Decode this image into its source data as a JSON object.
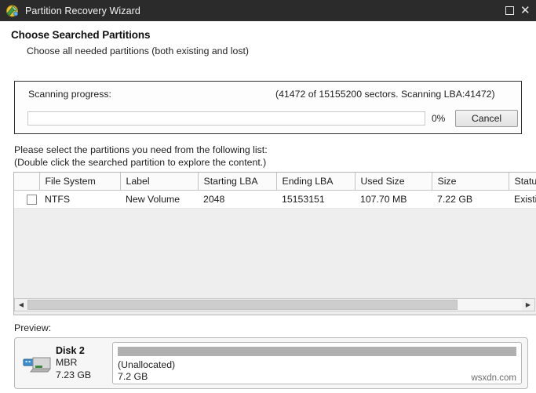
{
  "window": {
    "title": "Partition Recovery Wizard",
    "icon": "partition-wizard-icon",
    "maximize_label": "□",
    "close_label": "✕"
  },
  "header": {
    "title": "Choose Searched Partitions",
    "subtitle": "Choose all needed partitions (both existing and lost)"
  },
  "scanning": {
    "label": "Scanning progress:",
    "status": "(41472 of 15155200 sectors. Scanning LBA:41472)",
    "percent_label": "0%",
    "percent_value": 0,
    "cancel_label": "Cancel",
    "sectors_done": 41472,
    "sectors_total": 15155200,
    "current_lba": 41472
  },
  "instructions": {
    "line1": "Please select the partitions you need from the following list:",
    "line2": "(Double click the searched partition to explore the content.)"
  },
  "table": {
    "columns": [
      {
        "key": "check",
        "label": ""
      },
      {
        "key": "file_system",
        "label": "File System"
      },
      {
        "key": "label",
        "label": "Label"
      },
      {
        "key": "starting_lba",
        "label": "Starting LBA"
      },
      {
        "key": "ending_lba",
        "label": "Ending LBA"
      },
      {
        "key": "used_size",
        "label": "Used Size"
      },
      {
        "key": "size",
        "label": "Size"
      },
      {
        "key": "status",
        "label": "Status"
      }
    ],
    "rows": [
      {
        "checked": false,
        "file_system": "NTFS",
        "label": "New Volume",
        "starting_lba": "2048",
        "ending_lba": "15153151",
        "used_size": "107.70 MB",
        "size": "7.22 GB",
        "status": "Existing"
      }
    ],
    "scrollbar": {
      "left_arrow": "◀",
      "right_arrow": "▶",
      "thumb_percent": 87
    }
  },
  "preview": {
    "label": "Preview:",
    "disk": {
      "name": "Disk 2",
      "scheme": "MBR",
      "size": "7.23 GB",
      "icon": "usb-drive-icon"
    },
    "partitions": [
      {
        "name": "(Unallocated)",
        "size": "7.2 GB"
      }
    ]
  },
  "watermark": "wsxdn.com",
  "colors": {
    "titlebar_bg": "#2b2b2b",
    "titlebar_text": "#f2f2f2",
    "table_body_bg": "#eeeeee",
    "partition_bar": "#b0b0b0",
    "accent": "#4a90d9"
  }
}
